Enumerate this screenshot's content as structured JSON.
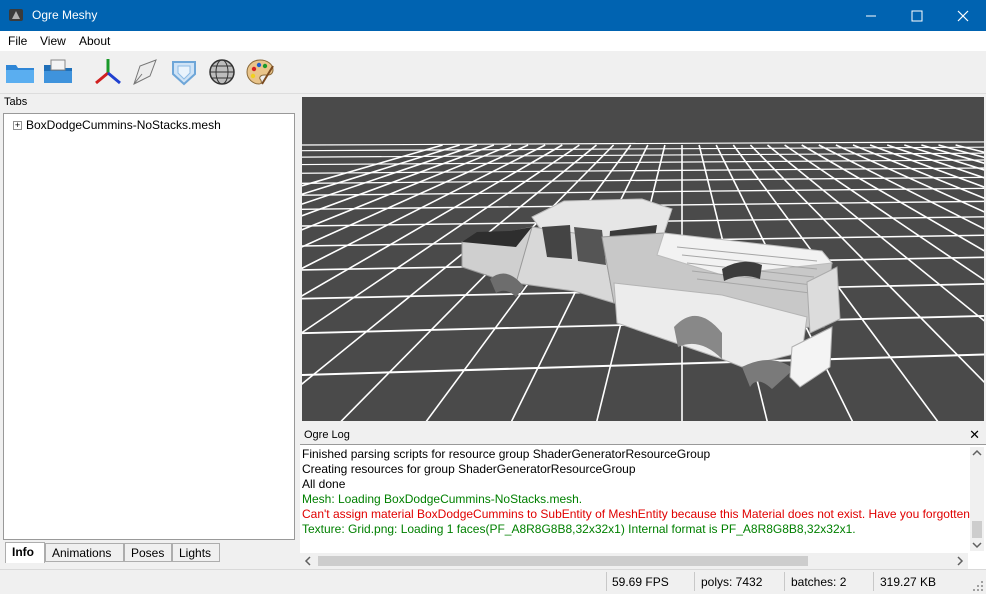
{
  "window": {
    "title": "Ogre Meshy"
  },
  "menu": {
    "file": "File",
    "view": "View",
    "about": "About"
  },
  "toolbar": {
    "icons": [
      "open-folder-icon",
      "open-archive-icon",
      "axes-icon",
      "normals-icon",
      "bounding-box-icon",
      "wireframe-sphere-icon",
      "material-palette-icon"
    ]
  },
  "left_pane": {
    "label": "Tabs",
    "tree": [
      {
        "label": "BoxDodgeCummins-NoStacks.mesh",
        "expander": "+"
      }
    ],
    "tabs": [
      "Info",
      "Animations",
      "Poses",
      "Lights"
    ],
    "active_tab": "Info"
  },
  "log": {
    "title": "Ogre Log",
    "close": "✕",
    "lines": [
      {
        "text": "Finished parsing scripts for resource group ShaderGeneratorResourceGroup",
        "color": "#000000"
      },
      {
        "text": "Creating resources for group ShaderGeneratorResourceGroup",
        "color": "#000000"
      },
      {
        "text": "All done",
        "color": "#000000"
      },
      {
        "text": "Mesh: Loading BoxDodgeCummins-NoStacks.mesh.",
        "color": "#008000"
      },
      {
        "text": "Can't assign material BoxDodgeCummins to SubEntity of MeshEntity because this Material does not exist. Have you forgotten to define it in a .material script?",
        "color": "#e00000"
      },
      {
        "text": "Texture: Grid.png: Loading 1 faces(PF_A8R8G8B8,32x32x1) Internal format is PF_A8R8G8B8,32x32x1.",
        "color": "#008000"
      }
    ]
  },
  "status": {
    "fps": "59.69 FPS",
    "polys": "polys: 7432",
    "batches": "batches: 2",
    "memory": "319.27 KB"
  },
  "colors": {
    "titlebar": "#0063b1",
    "viewport_bg": "#4a4a4a",
    "grid": "#ffffff"
  }
}
